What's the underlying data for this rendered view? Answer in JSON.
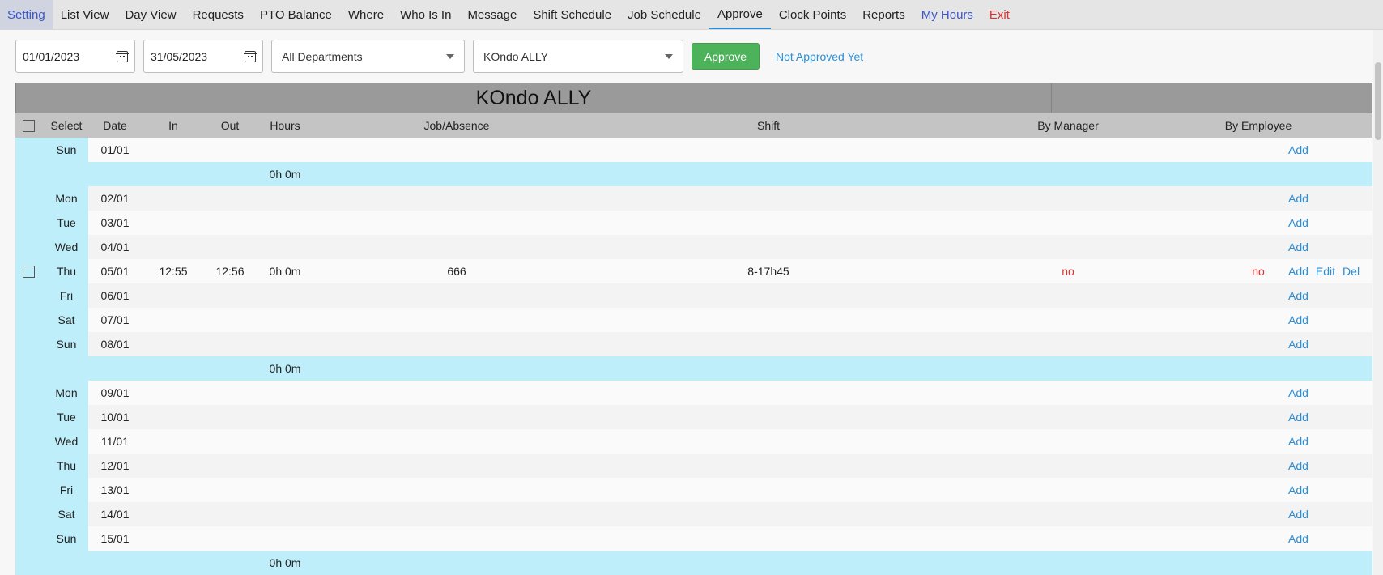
{
  "nav": {
    "items": [
      {
        "label": "Setting",
        "style": "first"
      },
      {
        "label": "List View",
        "style": ""
      },
      {
        "label": "Day View",
        "style": ""
      },
      {
        "label": "Requests",
        "style": ""
      },
      {
        "label": "PTO Balance",
        "style": ""
      },
      {
        "label": "Where",
        "style": ""
      },
      {
        "label": "Who Is In",
        "style": ""
      },
      {
        "label": "Message",
        "style": ""
      },
      {
        "label": "Shift Schedule",
        "style": ""
      },
      {
        "label": "Job Schedule",
        "style": ""
      },
      {
        "label": "Approve",
        "style": "active"
      },
      {
        "label": "Clock Points",
        "style": ""
      },
      {
        "label": "Reports",
        "style": ""
      },
      {
        "label": "My Hours",
        "style": "blue"
      },
      {
        "label": "Exit",
        "style": "red"
      }
    ]
  },
  "filters": {
    "start_date": "01/01/2023",
    "end_date": "31/05/2023",
    "department": "All Departments",
    "employee": "KOndo ALLY",
    "approve_label": "Approve",
    "status_link": "Not Approved Yet"
  },
  "sheet": {
    "employee_name": "KOndo ALLY",
    "columns": {
      "select": "Select",
      "date": "Date",
      "in": "In",
      "out": "Out",
      "hours": "Hours",
      "job": "Job/Absence",
      "shift": "Shift",
      "by_manager": "By Manager",
      "by_employee": "By Employee"
    },
    "rows": [
      {
        "type": "day",
        "day": "Sun",
        "date": "01/01"
      },
      {
        "type": "summary",
        "hours": "0h 0m"
      },
      {
        "type": "day",
        "day": "Mon",
        "date": "02/01"
      },
      {
        "type": "day",
        "day": "Tue",
        "date": "03/01"
      },
      {
        "type": "day",
        "day": "Wed",
        "date": "04/01"
      },
      {
        "type": "entry",
        "day": "Thu",
        "date": "05/01",
        "in": "12:55",
        "out": "12:56",
        "hours": "0h 0m",
        "job": "666",
        "shift": "8-17h45",
        "by_manager": "no",
        "by_employee": "no"
      },
      {
        "type": "day",
        "day": "Fri",
        "date": "06/01"
      },
      {
        "type": "day",
        "day": "Sat",
        "date": "07/01"
      },
      {
        "type": "day",
        "day": "Sun",
        "date": "08/01"
      },
      {
        "type": "summary",
        "hours": "0h 0m"
      },
      {
        "type": "day",
        "day": "Mon",
        "date": "09/01"
      },
      {
        "type": "day",
        "day": "Tue",
        "date": "10/01"
      },
      {
        "type": "day",
        "day": "Wed",
        "date": "11/01"
      },
      {
        "type": "day",
        "day": "Thu",
        "date": "12/01"
      },
      {
        "type": "day",
        "day": "Fri",
        "date": "13/01"
      },
      {
        "type": "day",
        "day": "Sat",
        "date": "14/01"
      },
      {
        "type": "day",
        "day": "Sun",
        "date": "15/01"
      },
      {
        "type": "summary",
        "hours": "0h 0m"
      }
    ],
    "actions": {
      "add": "Add",
      "edit": "Edit",
      "del": "Del"
    }
  },
  "colors": {
    "accent": "#2a8fd8",
    "approve": "#4cb35a",
    "row_highlight": "#bfeefb",
    "header": "#c4c4c4",
    "title_bar": "#9a9a9a",
    "danger": "#e03030"
  }
}
